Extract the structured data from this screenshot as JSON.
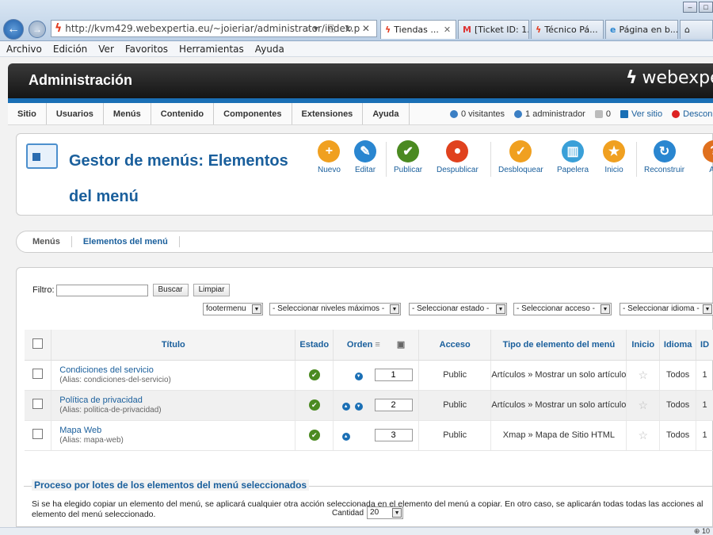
{
  "browser": {
    "url": "http://kvm429.webexpertia.eu/~joieriar/administrator/index.p",
    "url_domain": "webexpertia",
    "tabs": [
      "Tiendas ...",
      "[Ticket ID: 1...",
      "Técnico Pá...",
      "Página en b..."
    ],
    "menu": [
      "Archivo",
      "Edición",
      "Ver",
      "Favoritos",
      "Herramientas",
      "Ayuda"
    ],
    "status_zoom": "10"
  },
  "header": {
    "title": "Administración",
    "brand": "webexpe"
  },
  "top_nav": [
    "Sitio",
    "Usuarios",
    "Menús",
    "Contenido",
    "Componentes",
    "Extensiones",
    "Ayuda"
  ],
  "status": {
    "visitors": "0 visitantes",
    "admins": "1 administrador",
    "messages": "0",
    "view_site": "Ver sitio",
    "logout": "Descon"
  },
  "page_title": "Gestor de menús: Elementos del menú",
  "toolbar": [
    {
      "label": "Nuevo",
      "color": "#f0a020",
      "icon": "plus-icon",
      "glyph": "+"
    },
    {
      "label": "Editar",
      "color": "#2a86d0",
      "icon": "pencil-icon",
      "glyph": "✎"
    },
    {
      "label": "Publicar",
      "color": "#4b8a21",
      "icon": "check-icon",
      "glyph": "✔"
    },
    {
      "label": "Despublicar",
      "color": "#e0421e",
      "icon": "stop-icon",
      "glyph": "●"
    },
    {
      "label": "Desbloquear",
      "color": "#f0a020",
      "icon": "checkmark-icon",
      "glyph": "✓"
    },
    {
      "label": "Papelera",
      "color": "#3aa0d8",
      "icon": "trash-icon",
      "glyph": "▥"
    },
    {
      "label": "Inicio",
      "color": "#f0a020",
      "icon": "star-icon",
      "glyph": "★"
    },
    {
      "label": "Reconstruir",
      "color": "#2a86d0",
      "icon": "refresh-icon",
      "glyph": "↻"
    },
    {
      "label": "Ay",
      "color": "#e0701e",
      "icon": "help-icon",
      "glyph": "?"
    }
  ],
  "subnav": [
    "Menús",
    "Elementos del menú"
  ],
  "filter": {
    "label": "Filtro:",
    "value": "",
    "search": "Buscar",
    "clear": "Limpiar"
  },
  "selects": [
    "footermenu",
    "- Seleccionar niveles máximos -",
    "- Seleccionar estado -",
    "- Seleccionar acceso -",
    "- Seleccionar idioma -"
  ],
  "columns": [
    "Título",
    "Estado",
    "Orden",
    "Acceso",
    "Tipo de elemento del menú",
    "Inicio",
    "Idioma",
    "ID"
  ],
  "rows": [
    {
      "title": "Condiciones del servicio",
      "alias": "(Alias: condiciones-del-servicio)",
      "order": "1",
      "access": "Public",
      "type": "Artículos » Mostrar un solo artículo",
      "lang": "Todos",
      "id": "1"
    },
    {
      "title": "Política de privacidad",
      "alias": "(Alias: politica-de-privacidad)",
      "order": "2",
      "access": "Public",
      "type": "Artículos » Mostrar un solo artículo",
      "lang": "Todos",
      "id": "1"
    },
    {
      "title": "Mapa Web",
      "alias": "(Alias: mapa-web)",
      "order": "3",
      "access": "Public",
      "type": "Xmap » Mapa de Sitio HTML",
      "lang": "Todos",
      "id": "1"
    }
  ],
  "cantidad": {
    "label": "Cantidad",
    "value": "20"
  },
  "batch": {
    "title": "Proceso por lotes de los elementos del menú seleccionados",
    "text": "Si se ha elegido copiar un elemento del menú, se aplicará cualquier otra acción seleccionada en el elemento del menú a copiar. En otro caso, se aplicarán todas todas las acciones al elemento del menú seleccionado."
  }
}
